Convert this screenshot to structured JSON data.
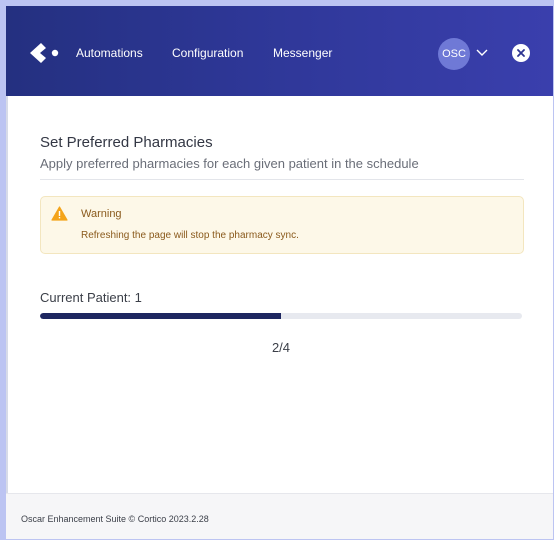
{
  "nav": {
    "links": [
      "Automations",
      "Configuration",
      "Messenger"
    ],
    "avatar_text": "OSC",
    "icons": {
      "logo": "arrow-logo",
      "menu": "chevron-down-icon",
      "close": "close-icon"
    },
    "gradient_colors": [
      "#243080",
      "#3a3fad"
    ]
  },
  "main": {
    "title": "Set Preferred Pharmacies",
    "subtitle": "Apply preferred pharmacies for each given patient in the schedule",
    "warning": {
      "icon": "warning-triangle-icon",
      "title": "Warning",
      "text": "Refreshing the page will stop the pharmacy sync."
    },
    "progress": {
      "label": "Current Patient: 1",
      "current": 2,
      "total": 4,
      "count_text": "2/4",
      "fill_color": "#1e2760"
    }
  },
  "footer": {
    "text": "Oscar Enhancement Suite © Cortico 2023.2.28"
  }
}
